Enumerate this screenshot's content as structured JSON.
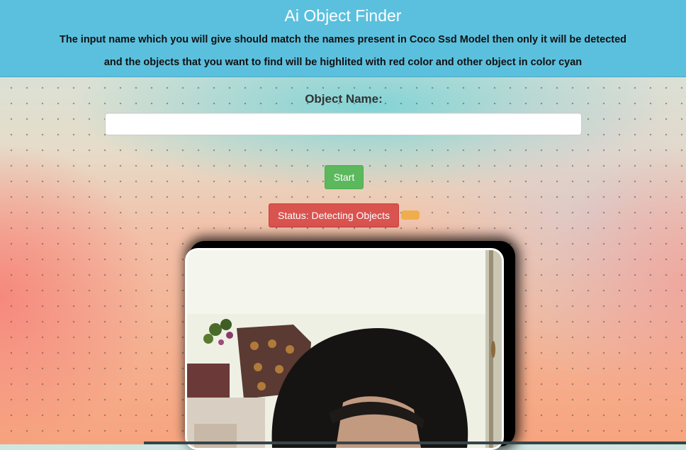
{
  "header": {
    "title": "Ai Object Finder",
    "description_line1": "The input name which you will give should match the names present in Coco Ssd Model then only it will be detected",
    "description_line2": "and the objects that you want to find will be highlited with red color and other object in color cyan",
    "background_color": "#5bc0de"
  },
  "form": {
    "object_name_label": "Object Name:",
    "object_name_value": "",
    "object_name_placeholder": "",
    "start_button_label": "Start",
    "start_button_color": "#5cb85c"
  },
  "status": {
    "text": "Status: Detecting Objects",
    "color": "#d9534f",
    "indicator_color": "#f0ad4e"
  },
  "video": {
    "feed_icon": "webcam-feed"
  }
}
